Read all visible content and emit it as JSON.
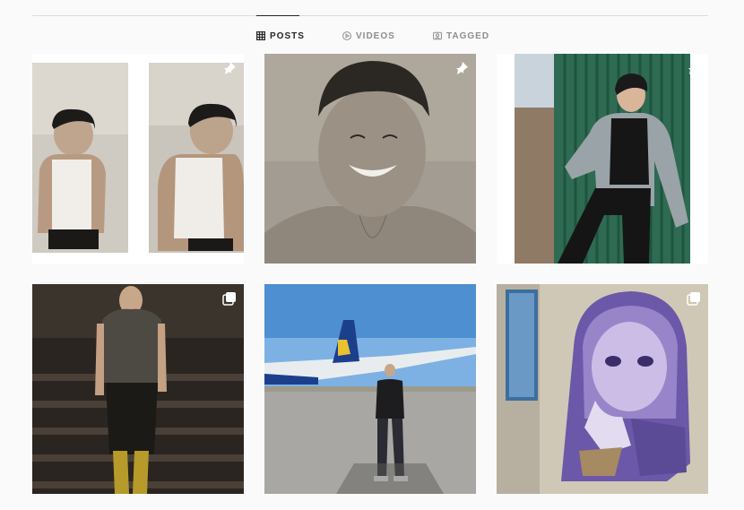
{
  "tabs": [
    {
      "label": "POSTS",
      "icon": "grid-icon",
      "active": true
    },
    {
      "label": "VIDEOS",
      "icon": "reels-icon",
      "active": false
    },
    {
      "label": "TAGGED",
      "icon": "tagged-icon",
      "active": false
    }
  ],
  "posts": [
    {
      "id": "post-1",
      "kind": "image",
      "subject": "two-portraits-white-tank-top",
      "badge": "pin-icon"
    },
    {
      "id": "post-2",
      "kind": "image",
      "subject": "smiling-portrait-sepia",
      "badge": "pin-icon"
    },
    {
      "id": "post-3",
      "kind": "image",
      "subject": "man-in-denim-jacket-green-wall",
      "badge": "pin-icon"
    },
    {
      "id": "post-4",
      "kind": "carousel",
      "subject": "runway-model-sequin-outfit",
      "badge": "carousel-icon"
    },
    {
      "id": "post-5",
      "kind": "image",
      "subject": "man-on-airport-tarmac-with-plane",
      "badge": null
    },
    {
      "id": "post-6",
      "kind": "carousel",
      "subject": "street-art-hooded-girl-mural",
      "badge": "carousel-icon"
    }
  ],
  "colors": {
    "background": "#fafafa",
    "divider": "#dbdbdb",
    "tab_active": "#262626",
    "tab_inactive": "#8e8e8e"
  }
}
